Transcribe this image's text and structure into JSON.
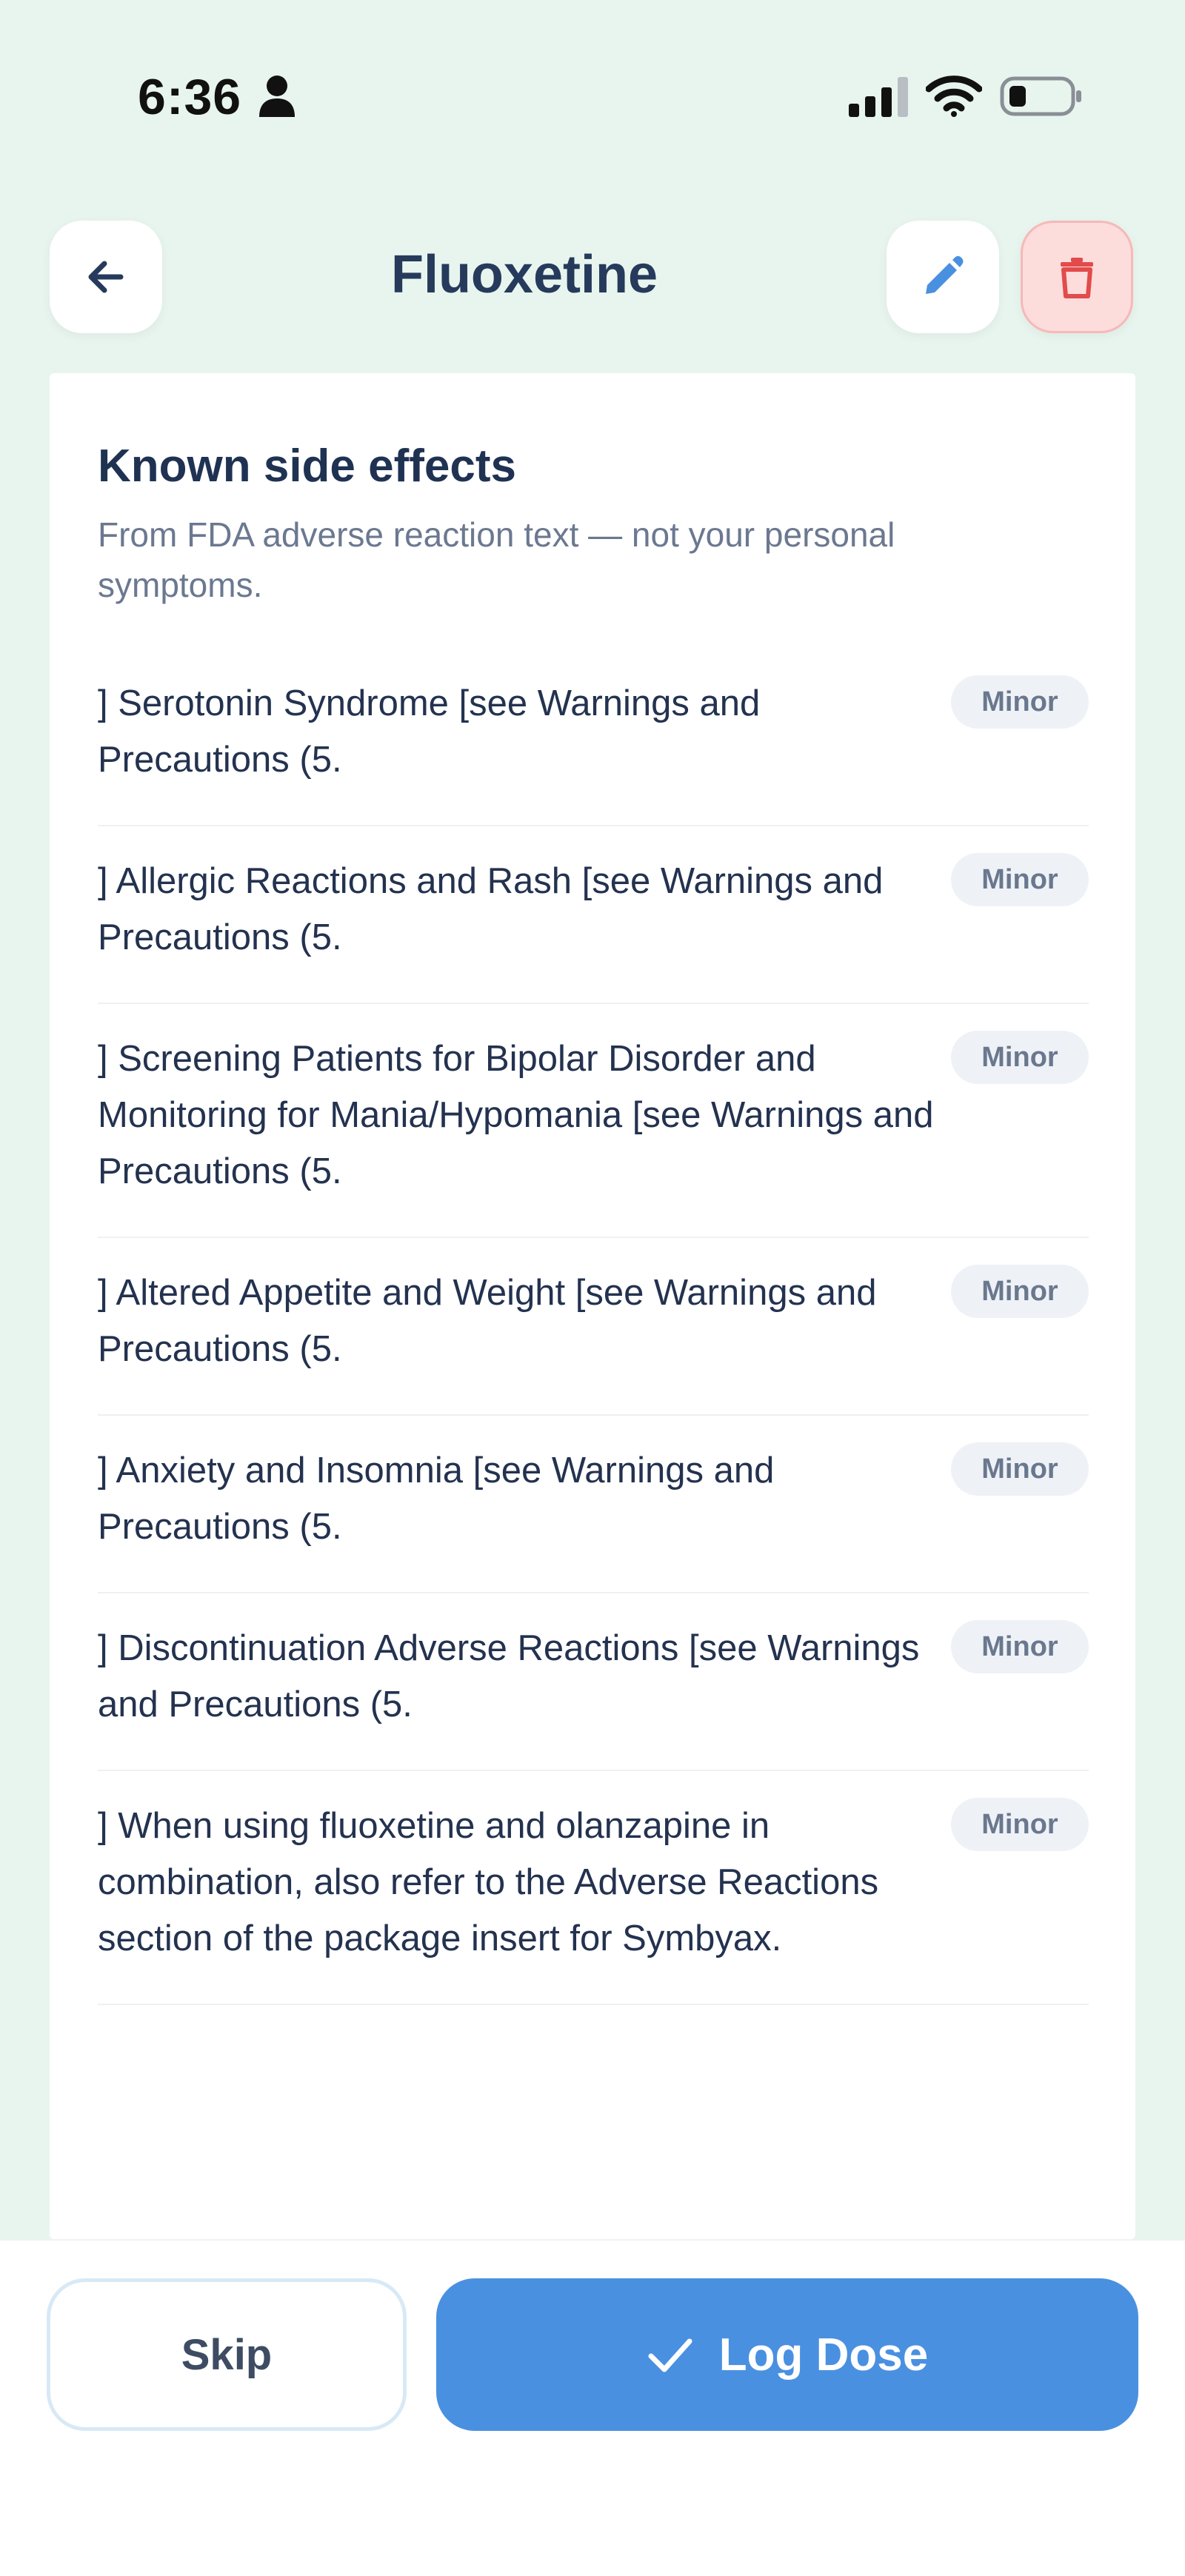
{
  "status_bar": {
    "time": "6:36",
    "icons": [
      "person-icon",
      "cellular-signal-icon",
      "wifi-icon",
      "battery-icon"
    ]
  },
  "header": {
    "title": "Fluoxetine",
    "back_icon": "arrow-left-icon",
    "edit_icon": "pencil-icon",
    "delete_icon": "trash-icon"
  },
  "side_effects": {
    "title": "Known side effects",
    "subtitle": "From FDA adverse reaction text — not your personal symptoms.",
    "items": [
      {
        "text": "] Serotonin Syndrome [see Warnings and Precautions (5.",
        "severity": "Minor"
      },
      {
        "text": "] Allergic Reactions and Rash [see Warnings and Precautions (5.",
        "severity": "Minor"
      },
      {
        "text": "] Screening Patients for Bipolar Disorder and Monitoring for Mania/Hypomania [see Warnings and Precautions (5.",
        "severity": "Minor"
      },
      {
        "text": "] Altered Appetite and Weight [see Warnings and Precautions (5.",
        "severity": "Minor"
      },
      {
        "text": "] Anxiety and Insomnia [see Warnings and Precautions (5.",
        "severity": "Minor"
      },
      {
        "text": "] Discontinuation Adverse Reactions [see Warnings and Precautions (5.",
        "severity": "Minor"
      },
      {
        "text": "] When using fluoxetine and olanzapine in combination, also refer to the Adverse Reactions section of the package insert for Symbyax.",
        "severity": "Minor"
      }
    ]
  },
  "actions": {
    "skip_label": "Skip",
    "log_label": "Log Dose",
    "log_icon": "checkmark-icon"
  },
  "colors": {
    "background": "#e8f5ee",
    "accent": "#4a90e0",
    "danger": "#e24b4b",
    "danger_bg": "#fddcdc",
    "badge_bg": "#eef2f7"
  }
}
